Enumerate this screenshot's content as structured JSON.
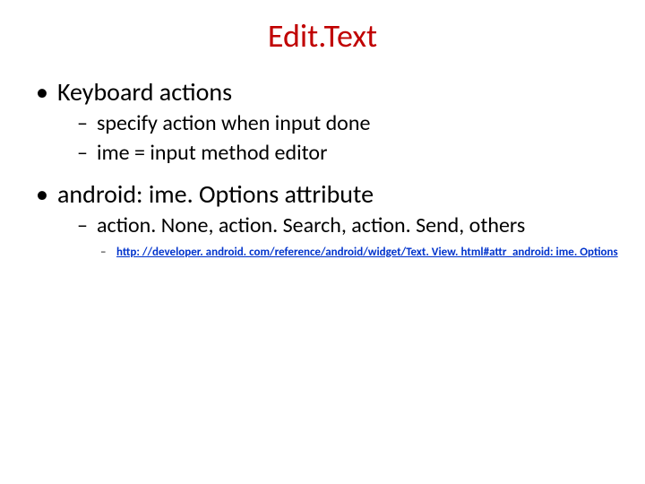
{
  "title": "Edit.Text",
  "bullets": {
    "b1": "Keyboard actions",
    "b1a": "specify action when input done",
    "b1b": "ime = input method editor",
    "b2": "android: ime. Options attribute",
    "b2a": "action. None, action. Search, action. Send, others",
    "b2b_link": "http: //developer. android. com/reference/android/widget/Text. View. html#attr_android: ime. Options"
  }
}
